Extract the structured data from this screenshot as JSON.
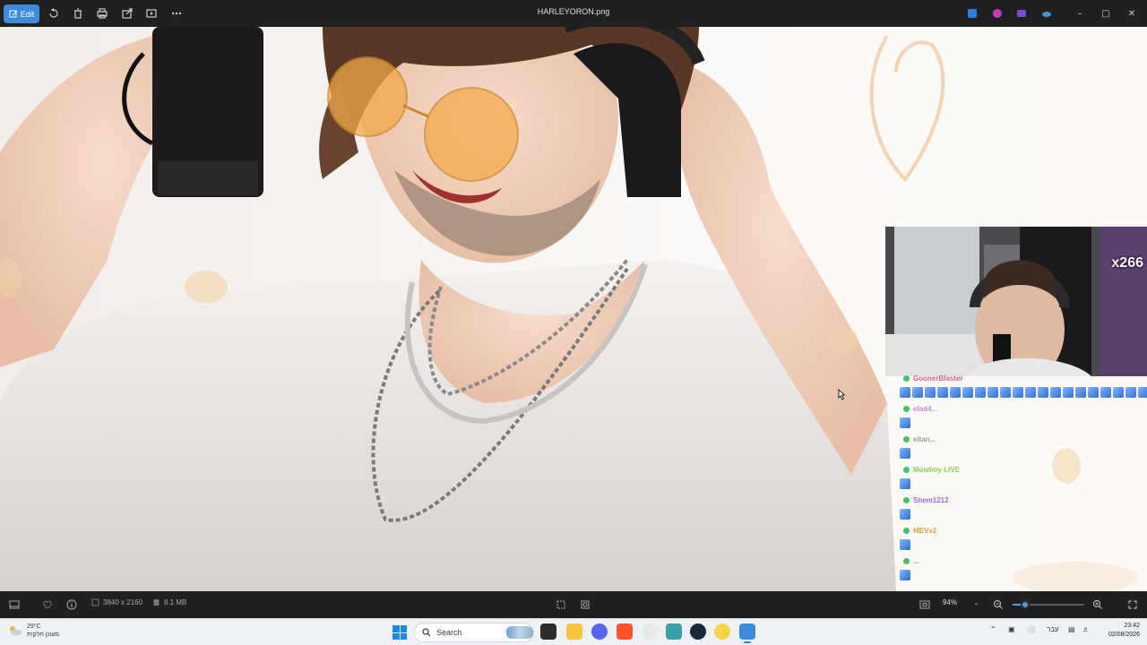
{
  "titlebar": {
    "edit_label": "Edit",
    "title": "HARLEYORON.png"
  },
  "chat": {
    "messages": [
      {
        "user": "GoonerBlaster",
        "color": "#e0607e",
        "emotes": 20
      },
      {
        "user": "elad4...",
        "color": "#c58ad8",
        "emotes": 1
      },
      {
        "user": "eitan...",
        "color": "#999999",
        "emotes": 1
      },
      {
        "user": "Mowboy LIVE",
        "color": "#8ed35a",
        "emotes": 1
      },
      {
        "user": "Shem1212",
        "color": "#9b6ad8",
        "emotes": 1
      },
      {
        "user": "MEVs2",
        "color": "#e0a23d",
        "emotes": 1
      },
      {
        "user": "...",
        "color": "#999999",
        "emotes": 1
      }
    ]
  },
  "webcam": {
    "badge": "x266"
  },
  "infobar": {
    "dimensions": "3840 x 2160",
    "filesize": "8.1 MB",
    "zoom": "94%",
    "zoom_fraction": 0.18
  },
  "taskbar": {
    "weather_temp": "29°C",
    "weather_desc": "מעונן חלקית",
    "search_placeholder": "Search",
    "language": "עבר",
    "time": "23:42",
    "date": "02/08/2026"
  },
  "colors": {
    "accent": "#3d8bd9",
    "chrome": "#202020",
    "taskbar": "#eef1f6"
  }
}
